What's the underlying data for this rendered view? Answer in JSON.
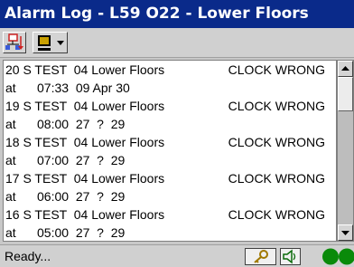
{
  "window": {
    "title": "Alarm Log - L59 O22 - Lower Floors"
  },
  "toolbar": {
    "buttons": [
      {
        "name": "tree-icon"
      },
      {
        "name": "monitor-icon"
      },
      {
        "name": "chevron-down-icon"
      }
    ]
  },
  "alarms": [
    {
      "line1": "20 S TEST  04 Lower Floors",
      "status": "CLOCK WRONG",
      "line2": "at      07:33  09 Apr 30"
    },
    {
      "line1": "19 S TEST  04 Lower Floors",
      "status": "CLOCK WRONG",
      "line2": "at      08:00  27  ?  29"
    },
    {
      "line1": "18 S TEST  04 Lower Floors",
      "status": "CLOCK WRONG",
      "line2": "at      07:00  27  ?  29"
    },
    {
      "line1": "17 S TEST  04 Lower Floors",
      "status": "CLOCK WRONG",
      "line2": "at      06:00  27  ?  29"
    },
    {
      "line1": "16 S TEST  04 Lower Floors",
      "status": "CLOCK WRONG",
      "line2": "at      05:00  27  ?  29"
    }
  ],
  "statusbar": {
    "text": "Ready...",
    "icons": [
      "key-icon",
      "speaker-icon",
      "connection-status-icon"
    ],
    "indicator_color": "#0a8a0a"
  },
  "colors": {
    "titlebar": "#0a2a8a",
    "background": "#c8c8c8"
  }
}
